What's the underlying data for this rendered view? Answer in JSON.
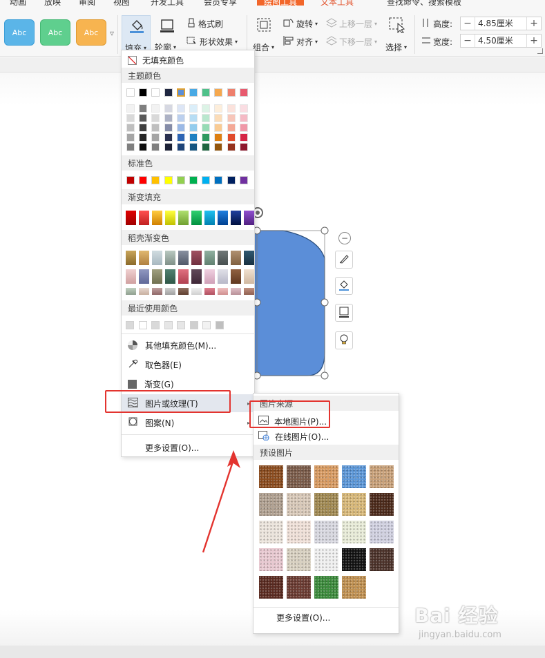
{
  "topbar": {
    "tabs": [
      "动画",
      "放映",
      "审阅",
      "视图",
      "开发工具",
      "会员专享",
      "绘图工具",
      "文本工具",
      "查找命令、搜索模板"
    ]
  },
  "ribbon": {
    "style_swatches": [
      {
        "label": "Abc",
        "color": "#5bb5e8"
      },
      {
        "label": "Abc",
        "color": "#5fcf8e"
      },
      {
        "label": "Abc",
        "color": "#f7b450"
      }
    ],
    "fill_label": "填充",
    "outline_label": "轮廓",
    "format_brush_label": "格式刷",
    "shape_effect_label": "形状效果",
    "group_label": "组合",
    "rotate_label": "旋转",
    "align_label": "对齐",
    "bring_forward_label": "上移一层",
    "send_backward_label": "下移一层",
    "select_label": "选择",
    "height_label": "高度:",
    "height_value": "4.85厘米",
    "width_label": "宽度:",
    "width_value": "4.50厘米"
  },
  "fill_menu": {
    "no_fill": "无填充颜色",
    "theme_colors_label": "主题颜色",
    "theme_colors": [
      "#ffffff",
      "#000000",
      "#ffffff",
      "#1f2640",
      "#5b8ed8",
      "#49a9e4",
      "#4fc18a",
      "#f5a84e",
      "#ee806d",
      "#e85a6e"
    ],
    "theme_shades": [
      [
        "#f2f2f2",
        "#7f7f7f",
        "#f2f2f2",
        "#d6d8e2",
        "#dde6f6",
        "#dbeef9",
        "#dcf3e6",
        "#fdeedb",
        "#fbe2dc",
        "#fadde2"
      ],
      [
        "#d9d9d9",
        "#595959",
        "#d9d9d9",
        "#adb2c5",
        "#bcd0ee",
        "#b7ddf4",
        "#b9e7ce",
        "#fbdcb8",
        "#f7c6ba",
        "#f5bac5"
      ],
      [
        "#bfbfbf",
        "#3f3f3f",
        "#bfbfbf",
        "#858ca8",
        "#9bb9e6",
        "#93cced",
        "#96dbb5",
        "#f9cb94",
        "#f4a997",
        "#f098a8"
      ],
      [
        "#a5a5a5",
        "#262626",
        "#a5a5a5",
        "#2a3150",
        "#2e65b4",
        "#1f81c2",
        "#2e9960",
        "#dd7f12",
        "#e04b2c",
        "#d52545"
      ],
      [
        "#7f7f7f",
        "#0d0d0d",
        "#7f7f7f",
        "#1c2136",
        "#1f4478",
        "#155681",
        "#1f6640",
        "#93550c",
        "#95321d",
        "#8e182e"
      ]
    ],
    "standard_label": "标准色",
    "standard_colors": [
      "#c00000",
      "#ff0000",
      "#ffc000",
      "#ffff00",
      "#92d050",
      "#00b050",
      "#00b0f0",
      "#0070c0",
      "#002060",
      "#7030a0"
    ],
    "gradient_label": "渐变填充",
    "gradient_colors": [
      [
        "#e00000",
        "#a00000"
      ],
      [
        "#ff5050",
        "#c02020"
      ],
      [
        "#ffcc40",
        "#d08000"
      ],
      [
        "#ffff40",
        "#c0c000"
      ],
      [
        "#b0e070",
        "#70a030"
      ],
      [
        "#30d070",
        "#009040"
      ],
      [
        "#20c0f0",
        "#0080b0"
      ],
      [
        "#2080e0",
        "#004090"
      ],
      [
        "#2040a0",
        "#001040"
      ],
      [
        "#9050d0",
        "#502080"
      ]
    ],
    "daoke_label": "稻壳渐变色",
    "daoke_rows": [
      [
        [
          "#c9a55a",
          "#8a6a2a"
        ],
        [
          "#e0b870",
          "#b08040"
        ],
        [
          "#d0dce0",
          "#a8b8c0"
        ],
        [
          "#b8c8c0",
          "#809088"
        ],
        [
          "#8890a0",
          "#505868"
        ],
        [
          "#a05060",
          "#703040"
        ],
        [
          "#90b0a0",
          "#608070"
        ],
        [
          "#707878",
          "#485050"
        ],
        [
          "#b09070",
          "#806040"
        ],
        [
          "#305870",
          "#183040"
        ]
      ],
      [
        [
          "#f0d0d0",
          "#d0a0a0"
        ],
        [
          "#9098c0",
          "#606898"
        ],
        [
          "#a0a080",
          "#707050"
        ],
        [
          "#508070",
          "#305848"
        ],
        [
          "#e07080",
          "#b04050"
        ],
        [
          "#604858",
          "#402838"
        ],
        [
          "#f0d0e0",
          "#d0a0b8"
        ],
        [
          "#e0e0e8",
          "#b8b8c8"
        ],
        [
          "#906040",
          "#603820"
        ],
        [
          "#f0e0d0",
          "#d0b8a0"
        ]
      ],
      [
        [
          "#c0d0c0",
          "#90a090"
        ],
        [
          "#e8d8d0",
          "#c8b0a0"
        ],
        [
          "#c0a0a0",
          "#906868"
        ],
        [
          "#d0d0d0",
          "#a0a0a0"
        ],
        [
          "#907060",
          "#604030"
        ],
        [
          "#f0f0f0",
          "#d0d0d0"
        ],
        [
          "#e08090",
          "#b05060"
        ],
        [
          "#f0c0c0",
          "#d09090"
        ],
        [
          "#e0c0c8",
          "#b89098"
        ],
        [
          "#c09080",
          "#906050"
        ]
      ]
    ],
    "recent_label": "最近使用颜色",
    "recent_colors": [
      "#d9d9d9",
      "#ffffff",
      "#d9d9d9",
      "#e6e6e6",
      "#e6e6e6",
      "#cfcfcf",
      "#f2f2f2",
      "#bfbfbf"
    ],
    "more_fill": "其他填充颜色(M)...",
    "eyedropper": "取色器(E)",
    "gradient": "渐变(G)",
    "picture_texture": "图片或纹理(T)",
    "pattern": "图案(N)",
    "more_settings": "更多设置(O)..."
  },
  "texture_menu": {
    "source_label": "图片来源",
    "local_image": "本地图片(P)...",
    "online_image": "在线图片(O)...",
    "preset_label": "预设图片",
    "textures": [
      [
        "#8a4a1c",
        "#7a5a48",
        "#d89a60",
        "#5a96d8",
        "#c8a078"
      ],
      [
        "#b0a090",
        "#d8c8b8",
        "#a08850",
        "#d8b878",
        "#4a2818"
      ],
      [
        "#ece4dc",
        "#f0e0d8",
        "#d8d8e0",
        "#e8ecd8",
        "#d0d0e0"
      ],
      [
        "#e8c8d0",
        "#d8d0c0",
        "#f0f0f0",
        "#101010",
        "#4a3028"
      ],
      [
        "#5a2a20",
        "#6a3a30",
        "#3a8a3a",
        "#c09050",
        null
      ]
    ],
    "more_settings": "更多设置(O)..."
  },
  "float_toolbar": [
    "collapse-icon",
    "brush-icon",
    "fill-bucket-icon",
    "outline-icon",
    "lightbulb-icon"
  ],
  "shape": {
    "fill": "#5b8ed8"
  },
  "watermark": {
    "brand": "Bai 经验",
    "url": "jingyan.baidu.com"
  }
}
